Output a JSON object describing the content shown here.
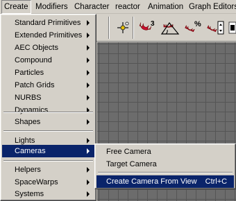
{
  "menubar": {
    "items": [
      {
        "label": "Create",
        "open": true
      },
      {
        "label": "Modifiers"
      },
      {
        "label": "Character"
      },
      {
        "label": "reactor"
      },
      {
        "label": "Animation"
      },
      {
        "label": "Graph Editors"
      }
    ]
  },
  "toolbar": {
    "icons": [
      "select-and-link-icon",
      "snap-3d-icon",
      "angle-snap-icon",
      "percent-snap-icon",
      "spinner-snap-icon",
      "named-selection-icon"
    ],
    "snap_label": "3",
    "percent_label": "%"
  },
  "create_menu": {
    "items": [
      {
        "label": "Standard Primitives",
        "submenu": true
      },
      {
        "label": "Extended Primitives",
        "submenu": true
      },
      {
        "label": "AEC Objects",
        "submenu": true
      },
      {
        "label": "Compound",
        "submenu": true
      },
      {
        "label": "Particles",
        "submenu": true
      },
      {
        "label": "Patch Grids",
        "submenu": true
      },
      {
        "label": "NURBS",
        "submenu": true
      },
      {
        "label": "Dynamics",
        "submenu": true
      },
      {
        "label": "Shapes",
        "submenu": true
      },
      {
        "label": "Lights",
        "submenu": true
      },
      {
        "label": "Cameras",
        "submenu": true,
        "highlighted": true
      },
      {
        "label": "Helpers",
        "submenu": true
      },
      {
        "label": "SpaceWarps",
        "submenu": true
      },
      {
        "label": "Systems",
        "submenu": true
      }
    ]
  },
  "cameras_submenu": {
    "items": [
      {
        "label": "Free Camera"
      },
      {
        "label": "Target Camera"
      },
      {
        "label": "Create Camera From View",
        "shortcut": "Ctrl+C",
        "highlighted": true
      }
    ]
  },
  "colors": {
    "menu_bg": "#d4d0c8",
    "highlight": "#0a246a",
    "highlight_text": "#ffffff",
    "viewport_bg": "#6c6c6c",
    "snap_magnet_red": "#c8102e"
  }
}
